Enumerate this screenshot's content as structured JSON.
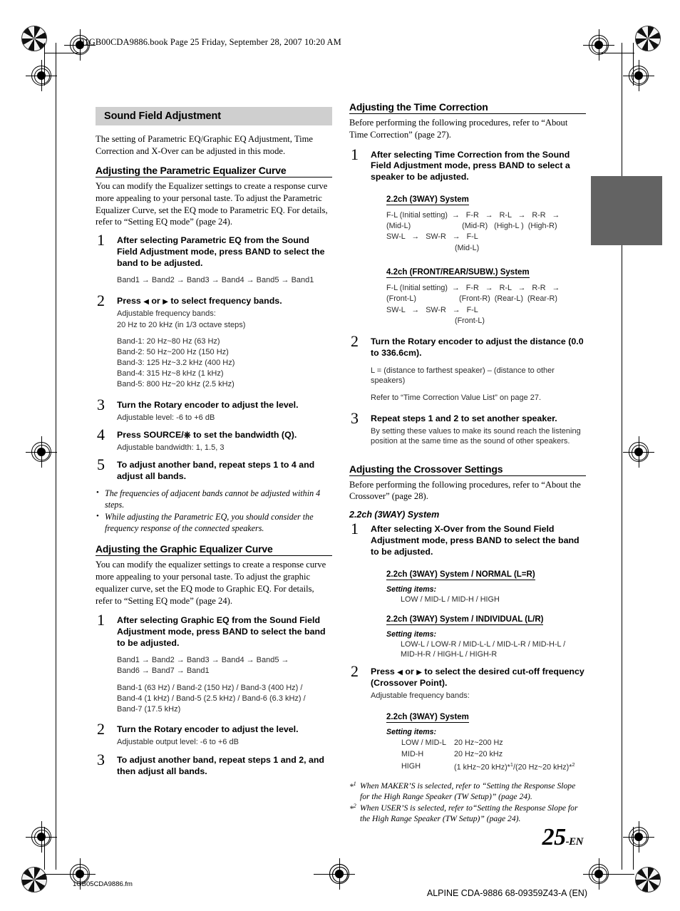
{
  "header": {
    "book_line": "01GB00CDA9886.book  Page 25  Friday, September 28, 2007  10:20 AM"
  },
  "footer": {
    "page_number": "25",
    "page_suffix": "-EN",
    "fm_file": "1GB05CDA9886.fm",
    "model_line": "ALPINE CDA-9886 68-09359Z43-A (EN)"
  },
  "left_column": {
    "section_title": "Sound Field Adjustment",
    "intro": "The setting of Parametric EQ/Graphic EQ Adjustment, Time Correction and X-Over can be adjusted in this mode.",
    "parametric": {
      "heading": "Adjusting the Parametric Equalizer Curve",
      "intro": "You can modify the Equalizer settings to create a response curve more appealing to your personal taste. To adjust the Parametric Equalizer Curve, set the EQ mode to Parametric EQ. For details, refer to “Setting EQ mode” (page 24).",
      "step1_num": "1",
      "step1_a": "After selecting Parametric EQ from the Sound Field Adjustment mode, press ",
      "step1_key": "BAND",
      "step1_b": " to select the band to be adjusted.",
      "step1_flow": "Band1 → Band2 → Band3 → Band4 → Band5 → Band1",
      "step2_num": "2",
      "step2_head_a": "Press ",
      "step2_head_b": " or ",
      "step2_head_c": " to select frequency bands.",
      "step2_sub1": "Adjustable frequency bands:",
      "step2_sub2": "20 Hz to 20 kHz (in 1/3 octave steps)",
      "step2_bands": [
        "Band-1: 20 Hz~80 Hz (63 Hz)",
        "Band-2: 50 Hz~200 Hz (150 Hz)",
        "Band-3: 125 Hz~3.2 kHz (400 Hz)",
        "Band-4: 315 Hz~8 kHz (1 kHz)",
        "Band-5: 800 Hz~20 kHz (2.5 kHz)"
      ],
      "step3_num": "3",
      "step3_a": "Turn the ",
      "step3_key": "Rotary encoder",
      "step3_b": " to adjust the level.",
      "step3_sub": "Adjustable level: -6 to +6 dB",
      "step4_num": "4",
      "step4_a": "Press ",
      "step4_key": "SOURCE/",
      "step4_b": " to set the bandwidth (Q).",
      "step4_sub": "Adjustable bandwidth: 1, 1.5, 3",
      "step5_num": "5",
      "step5_head": "To adjust another band, repeat steps 1 to 4 and adjust all bands.",
      "notes": [
        "The frequencies of adjacent bands cannot be adjusted within 4 steps.",
        "While adjusting the Parametric EQ, you should consider the frequency response of the connected speakers."
      ]
    },
    "graphic": {
      "heading": "Adjusting the Graphic Equalizer Curve",
      "intro": "You can modify the equalizer settings to create a response curve more appealing to your personal taste. To adjust the graphic equalizer curve, set the EQ mode to Graphic EQ. For details, refer to “Setting EQ mode” (page 24).",
      "step1_num": "1",
      "step1_a": "After selecting Graphic EQ from the Sound Field Adjustment mode, press ",
      "step1_key": "BAND",
      "step1_b": " to select the band to be adjusted.",
      "step1_flow_l1": "Band1 → Band2 → Band3 → Band4 → Band5 →",
      "step1_flow_l2": "Band6 → Band7 → Band1",
      "step1_freqs_l1": "Band-1 (63 Hz) / Band-2 (150 Hz) / Band-3 (400 Hz) /",
      "step1_freqs_l2": "Band-4 (1 kHz) / Band-5 (2.5 kHz) / Band-6 (6.3 kHz) /",
      "step1_freqs_l3": "Band-7 (17.5 kHz)",
      "step2_num": "2",
      "step2_a": "Turn the ",
      "step2_key": "Rotary encoder",
      "step2_b": " to adjust the level.",
      "step2_sub": "Adjustable output level: -6 to +6 dB",
      "step3_num": "3",
      "step3_head": "To adjust another band, repeat steps 1 and 2, and then adjust all bands."
    }
  },
  "right_column": {
    "time_correction": {
      "heading": "Adjusting the Time Correction",
      "intro": "Before performing the following procedures, refer to “About Time Correction” (page 27).",
      "step1_num": "1",
      "step1_a": "After selecting Time Correction from the Sound Field Adjustment mode, press ",
      "step1_key": "BAND",
      "step1_b": " to select a speaker to be adjusted.",
      "sys1_title": "2.2ch (3WAY) System",
      "sys1_l1": "F-L (Initial setting)  →   F-R   →   R-L   →   R-R   →",
      "sys1_l2": "(Mid-L)                        (Mid-R)   (High-L )  (High-R)",
      "sys1_l3": "SW-L   →   SW-R   →   F-L",
      "sys1_l4": "                                (Mid-L)",
      "sys2_title": "4.2ch (FRONT/REAR/SUBW.) System",
      "sys2_l1": "F-L (Initial setting)  →   F-R   →   R-L   →   R-R   →",
      "sys2_l2": "(Front-L)                    (Front-R)  (Rear-L)  (Rear-R)",
      "sys2_l3": "SW-L   →   SW-R   →   F-L",
      "sys2_l4": "                                (Front-L)",
      "step2_num": "2",
      "step2_a": "Turn the ",
      "step2_key": "Rotary encoder",
      "step2_b": " to adjust the distance (0.0 to 336.6cm).",
      "step2_sub_l1": "L = (distance to farthest speaker) – (distance to other",
      "step2_sub_l2": "      speakers)",
      "step2_sub2": "Refer to “Time Correction Value List” on page 27.",
      "step3_num": "3",
      "step3_head": "Repeat steps 1 and 2 to set another speaker.",
      "step3_sub": "By setting these values to make its sound reach the listening position at the same time as the sound of other speakers."
    },
    "crossover": {
      "heading": "Adjusting the Crossover Settings",
      "intro": "Before performing the following procedures, refer to “About the Crossover” (page 28).",
      "subheading": "2.2ch (3WAY) System",
      "step1_num": "1",
      "step1_a": "After selecting X-Over from the Sound Field Adjustment mode, press ",
      "step1_key": "BAND",
      "step1_b": " to select the band to be adjusted.",
      "normal_title": "2.2ch (3WAY) System / NORMAL (L=R)",
      "normal_label": "Setting items:",
      "normal_values": "LOW / MID-L / MID-H / HIGH",
      "individual_title": "2.2ch (3WAY) System / INDIVIDUAL (L/R)",
      "individual_label": "Setting items:",
      "individual_values_l1": "LOW-L / LOW-R / MID-L-L / MID-L-R / MID-H-L /",
      "individual_values_l2": "MID-H-R / HIGH-L / HIGH-R",
      "step2_num": "2",
      "step2_head_a": "Press ",
      "step2_head_b": " or ",
      "step2_head_c": " to select the desired cut-off frequency (Crossover Point).",
      "step2_sub": "Adjustable frequency bands:",
      "step2_sys_title": "2.2ch (3WAY) System",
      "step2_label": "Setting items:",
      "step2_row1_name": "LOW / MID-L",
      "step2_row1_val": "20 Hz~200 Hz",
      "step2_row2_name": "MID-H",
      "step2_row2_val": "20 Hz~20 kHz",
      "step2_row3_name": "HIGH",
      "step2_row3_val_a": "(1 kHz~20 kHz)*",
      "step2_row3_sup1": "1",
      "step2_row3_val_b": "/(20 Hz~20 kHz)*",
      "step2_row3_sup2": "2",
      "footnote1_mark": "*",
      "footnote1_sup": "1",
      "footnote1_text": "When MAKER’S is selected, refer to “Setting the Response Slope for the High Range Speaker (TW Setup)” (page 24).",
      "footnote2_mark": "*",
      "footnote2_sup": "2",
      "footnote2_text": "When USER’S is selected, refer to“Setting the Response Slope for the High Range Speaker (TW Setup)” (page 24)."
    }
  }
}
